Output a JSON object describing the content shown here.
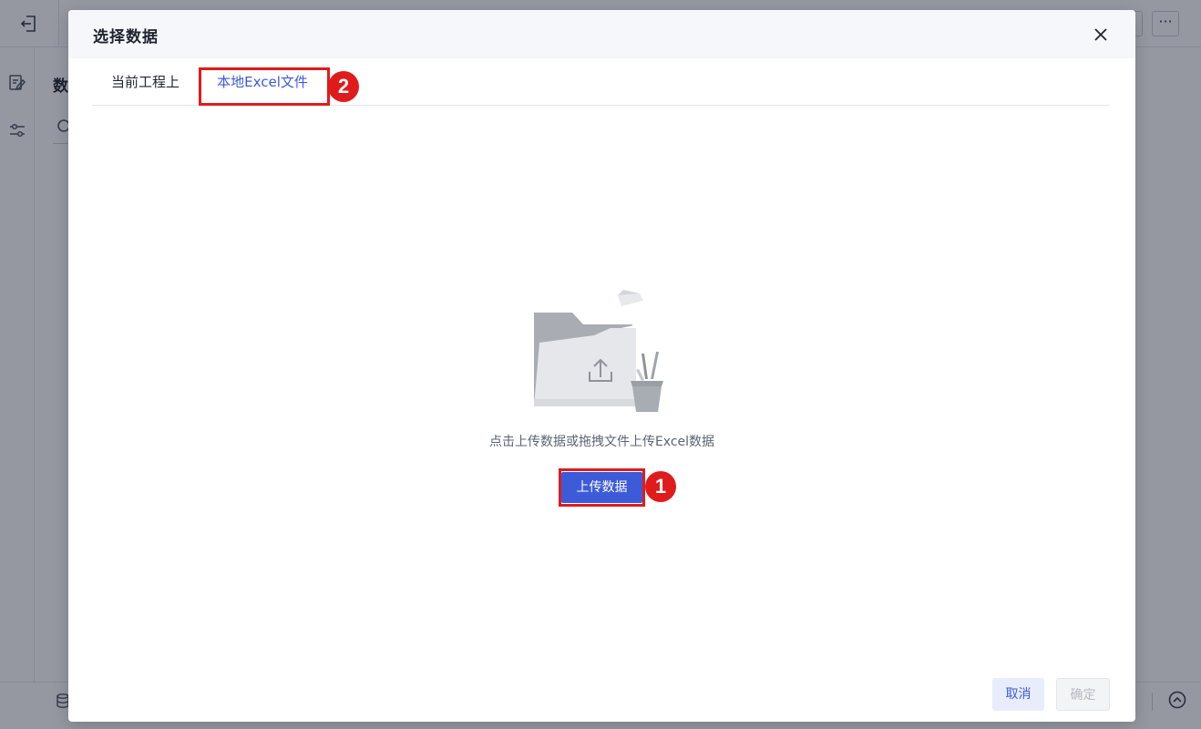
{
  "app": {
    "heading_partial": "数",
    "more_label": "···"
  },
  "modal": {
    "title": "选择数据",
    "tabs": [
      {
        "label": "当前工程上",
        "active": false
      },
      {
        "label": "本地Excel文件",
        "active": true
      }
    ],
    "upload_hint": "点击上传数据或拖拽文件上传Excel数据",
    "upload_button": "上传数据",
    "cancel_button": "取消",
    "confirm_button": "确定"
  },
  "annotations": {
    "badge_1": "1",
    "badge_2": "2"
  },
  "colors": {
    "accent": "#3d5bd8",
    "highlight": "#e01b1b"
  },
  "icons": [
    "exit-icon",
    "edit-icon",
    "filter-icon",
    "search-icon",
    "database-icon",
    "collapse-up-icon",
    "close-icon",
    "folder-upload-illustration"
  ]
}
